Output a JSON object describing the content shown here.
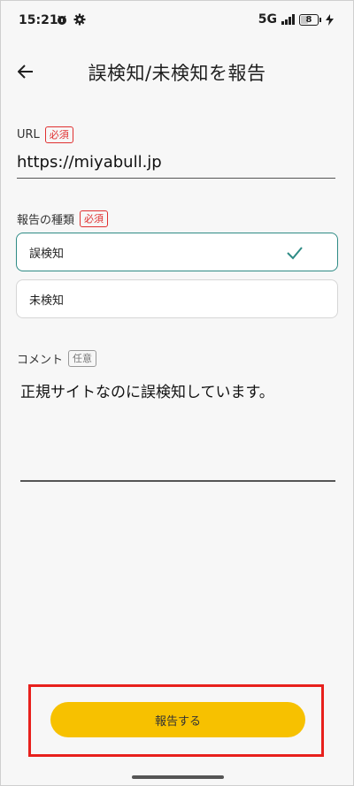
{
  "status_bar": {
    "time": "15:21",
    "network": "5G",
    "battery_level": "8",
    "icons": [
      "app-notification-icon",
      "gear-icon",
      "signal-icon",
      "battery-icon",
      "charging-icon"
    ]
  },
  "app_bar": {
    "title": "誤検知/未検知を報告",
    "back_icon": "arrow-left-icon"
  },
  "form": {
    "url": {
      "label": "URL",
      "badge": "必須",
      "value": "https://miyabull.jp"
    },
    "report_type": {
      "label": "報告の種類",
      "badge": "必須",
      "options": [
        {
          "label": "誤検知",
          "selected": true
        },
        {
          "label": "未検知",
          "selected": false
        }
      ]
    },
    "comment": {
      "label": "コメント",
      "badge": "任意",
      "value": "正規サイトなのに誤検知しています。"
    },
    "submit_label": "報告する"
  },
  "colors": {
    "accent": "#f7c100",
    "selected_border": "#2e8b85",
    "required_badge": "#e03030",
    "highlight_box": "#e8201c"
  }
}
